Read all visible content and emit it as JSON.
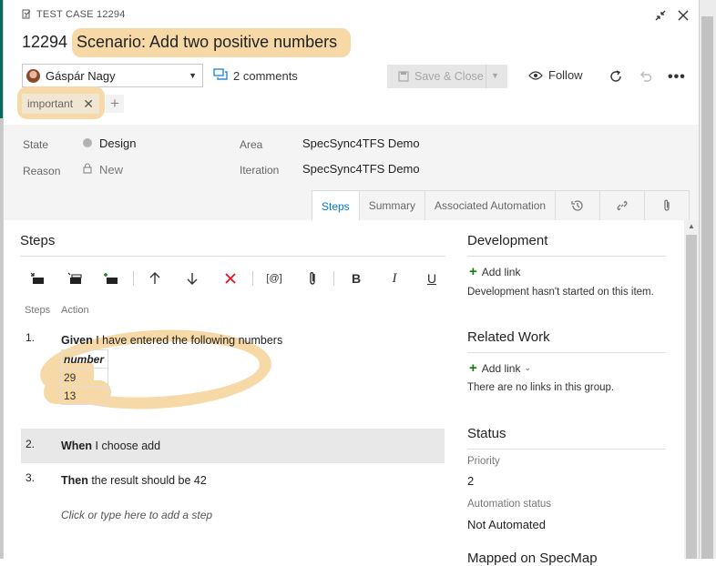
{
  "header": {
    "work_item_type": "TEST CASE 12294",
    "id": "12294",
    "title": "Scenario: Add two positive numbers",
    "assignee": "Gáspár Nagy",
    "comments_label": "2 comments",
    "save_label": "Save & Close",
    "follow_label": "Follow",
    "tags": [
      "important"
    ]
  },
  "fields": {
    "state_label": "State",
    "state_value": "Design",
    "reason_label": "Reason",
    "reason_value": "New",
    "area_label": "Area",
    "area_value": "SpecSync4TFS Demo",
    "iteration_label": "Iteration",
    "iteration_value": "SpecSync4TFS Demo"
  },
  "tabs": [
    "Steps",
    "Summary",
    "Associated Automation"
  ],
  "tab_icons": [
    "history-icon",
    "link-icon",
    "attachment-icon"
  ],
  "steps_panel": {
    "heading": "Steps",
    "col_steps": "Steps",
    "col_action": "Action",
    "toolbar": [
      "insert-step-icon",
      "insert-shared-steps-icon",
      "create-shared-steps-icon",
      "move-up-icon",
      "move-down-icon",
      "delete-icon",
      "insert-parameter-icon",
      "attach-icon",
      "bold-icon",
      "italic-icon",
      "underline-icon"
    ],
    "steps": [
      {
        "num": "1.",
        "keyword": "Given",
        "text": " I have entered the following numbers",
        "table": {
          "header": "number",
          "rows": [
            "29",
            "13"
          ]
        }
      },
      {
        "num": "2.",
        "keyword": "When",
        "text": " I choose add"
      },
      {
        "num": "3.",
        "keyword": "Then",
        "text": " the result should be 42"
      }
    ],
    "add_step_placeholder": "Click or type here to add a step"
  },
  "development": {
    "title": "Development",
    "add_link": "Add link",
    "empty_text": "Development hasn't started on this item."
  },
  "related_work": {
    "title": "Related Work",
    "add_link": "Add link",
    "empty_text": "There are no links in this group."
  },
  "status": {
    "title": "Status",
    "priority_label": "Priority",
    "priority_value": "2",
    "automation_label": "Automation status",
    "automation_value": "Not Automated"
  },
  "mapped_section_title": "Mapped on SpecMap",
  "colors": {
    "accent": "#0078d4",
    "highlight": "#f7d9a7",
    "add_green": "#107c10",
    "delete_red": "#e81123"
  }
}
